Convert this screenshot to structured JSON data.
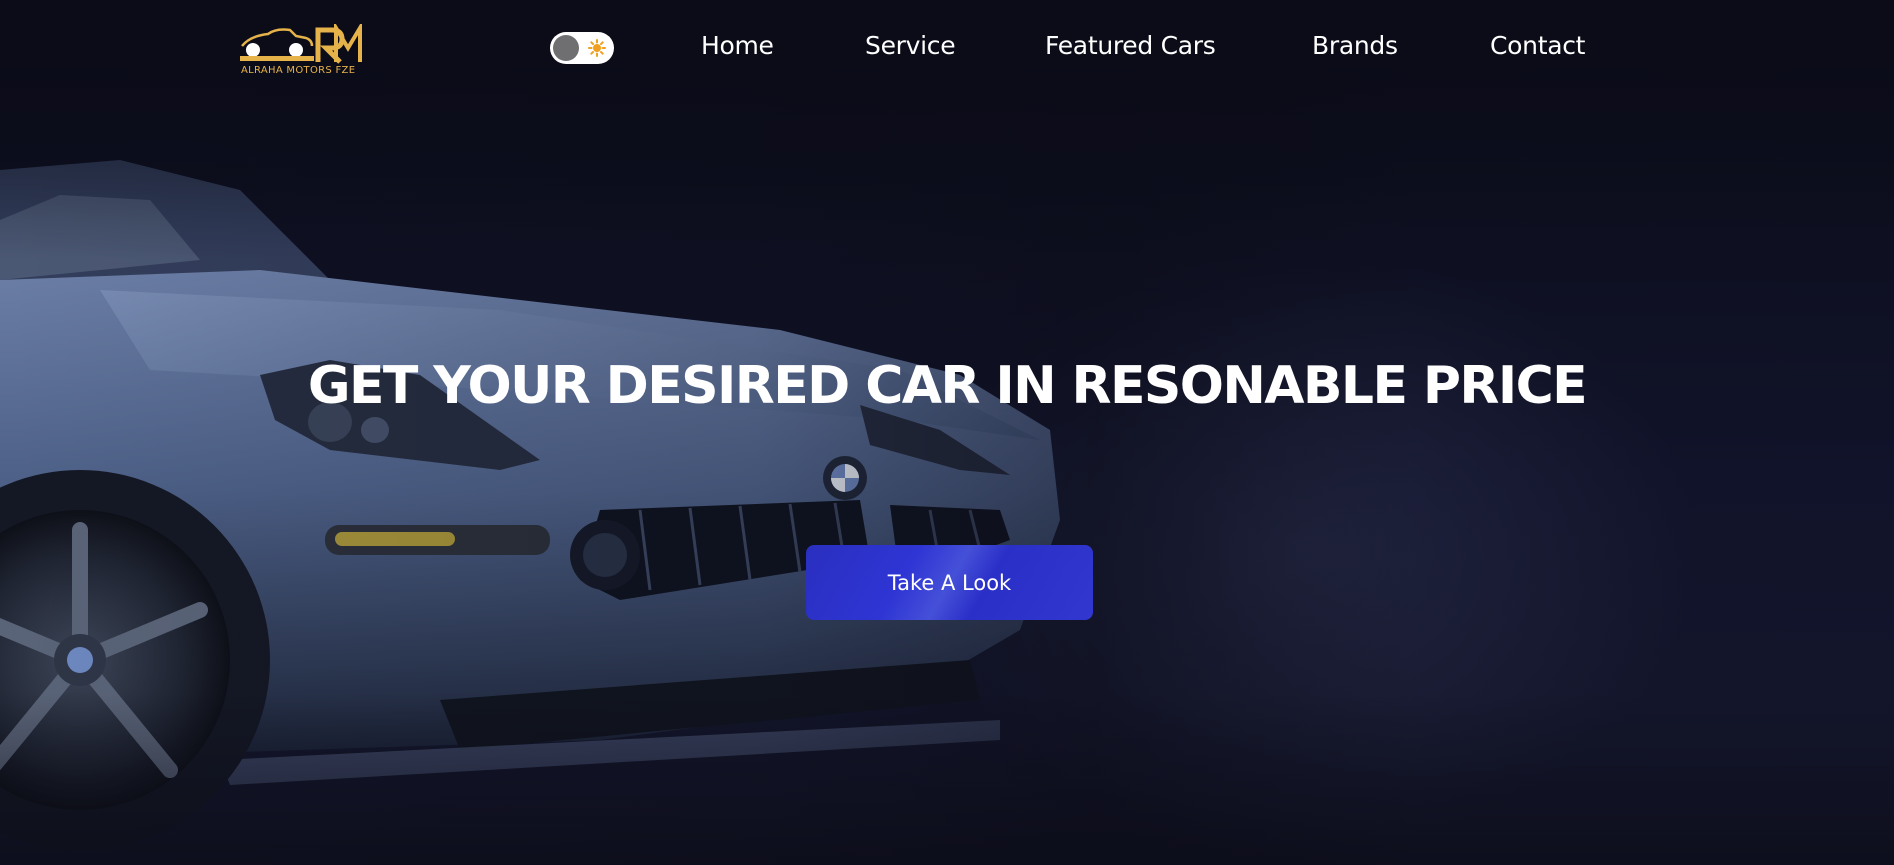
{
  "brand": {
    "name": "ALRAHA MOTORS FZE",
    "accent_color": "#e6b24a"
  },
  "theme_toggle": {
    "state": "light",
    "icon": "sun-icon"
  },
  "nav": {
    "items": [
      {
        "label": "Home"
      },
      {
        "label": "Service"
      },
      {
        "label": "Featured Cars"
      },
      {
        "label": "Brands"
      },
      {
        "label": "Contact"
      }
    ]
  },
  "hero": {
    "headline": "GET YOUR DESIRED CAR IN RESONABLE PRICE",
    "cta_label": "Take A Look",
    "background_color": "#0c0d1a",
    "button_color": "#2e35d4"
  }
}
